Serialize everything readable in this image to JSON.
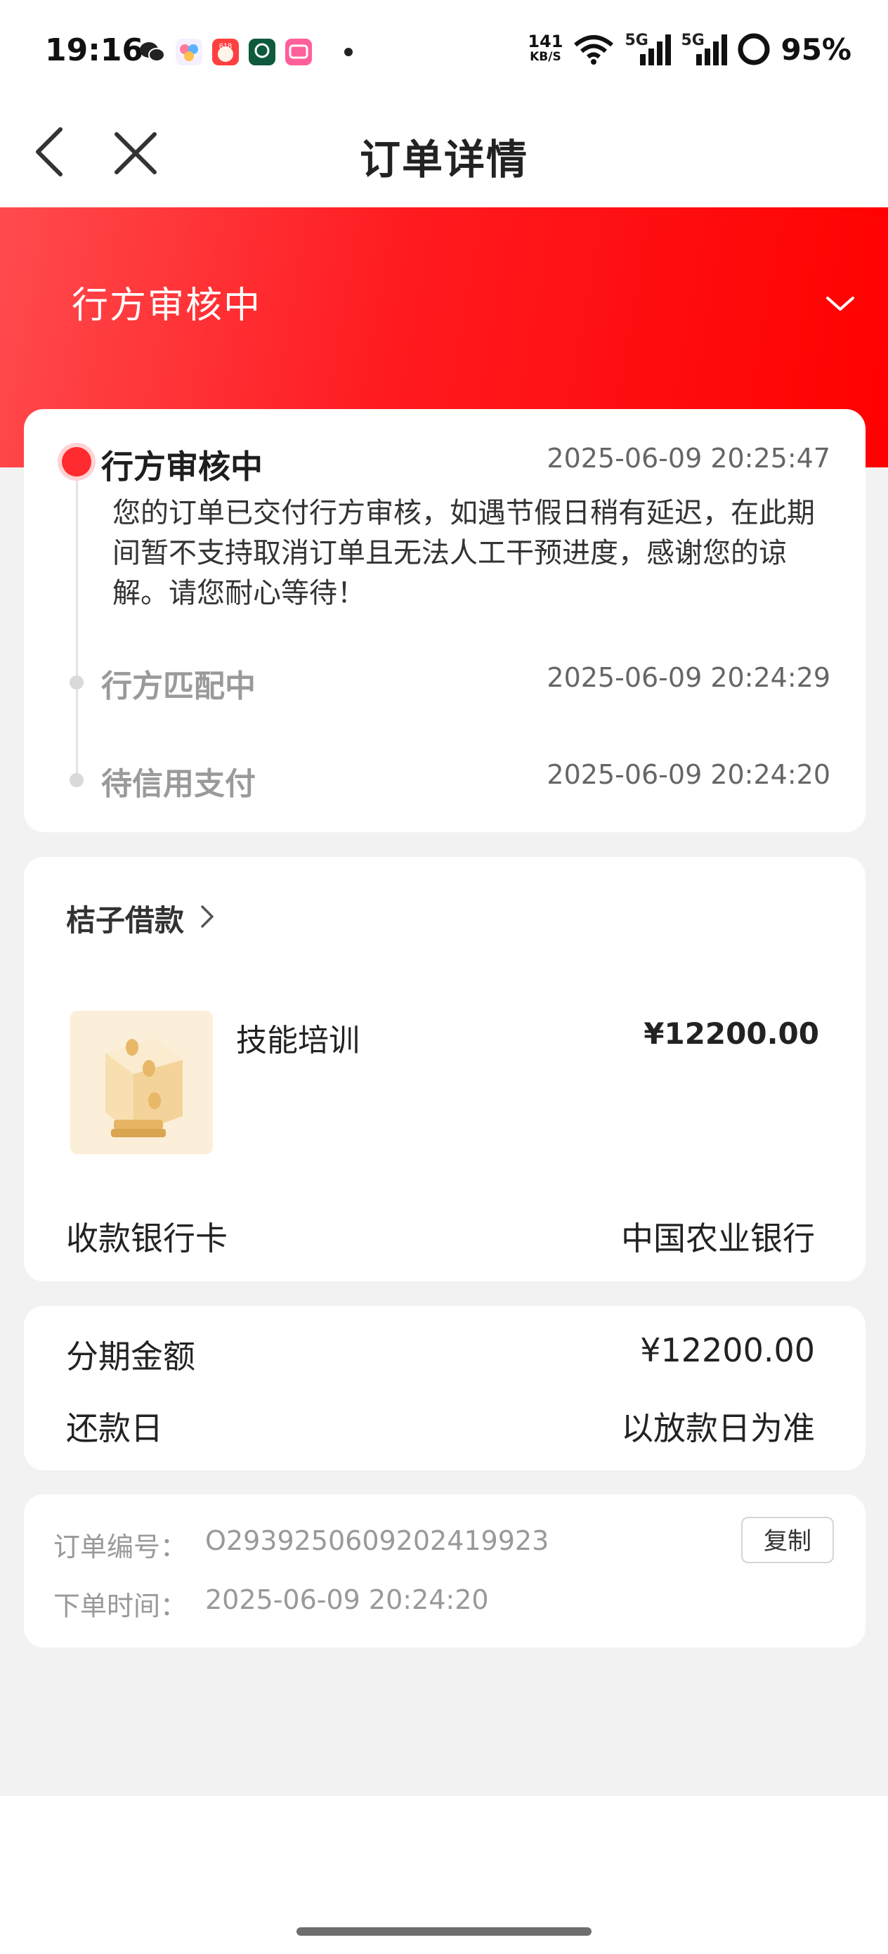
{
  "status_bar": {
    "time": "19:16",
    "net_speed_value": "141",
    "net_speed_unit": "KB/S",
    "signal_1_label": "5G",
    "signal_2_label": "5G",
    "battery_percent": "95%",
    "icons": [
      "wechat-icon",
      "app-icon",
      "618-app-icon",
      "green-app-icon",
      "bilibili-icon",
      "wifi-icon",
      "signal-icon",
      "battery-icon"
    ]
  },
  "nav": {
    "title": "订单详情"
  },
  "status_header": {
    "title": "行方审核中"
  },
  "timeline": {
    "steps": [
      {
        "title": "行方审核中",
        "time": "2025-06-09 20:25:47",
        "description": "您的订单已交付行方审核，如遇节假日稍有延迟，在此期间暂不支持取消订单且无法人工干预进度，感谢您的谅解。请您耐心等待！",
        "active": true
      },
      {
        "title": "行方匹配中",
        "time": "2025-06-09 20:24:29",
        "active": false
      },
      {
        "title": "待信用支付",
        "time": "2025-06-09 20:24:20",
        "active": false
      }
    ]
  },
  "order": {
    "merchant": "桔子借款",
    "product_name": "技能培训",
    "product_price": "¥12200.00",
    "bank_label": "收款银行卡",
    "bank_value": "中国农业银行"
  },
  "installment": {
    "amount_label": "分期金额",
    "amount_value": "¥12200.00",
    "repay_label": "还款日",
    "repay_value": "以放款日为准"
  },
  "meta": {
    "order_no_label": "订单编号：",
    "order_no_value": "O2939250609202419923",
    "copy_label": "复制",
    "order_time_label": "下单时间：",
    "order_time_value": "2025-06-09 20:24:20"
  },
  "colors": {
    "accent_red": "#ff1a1f",
    "page_bg": "#f2f2f2"
  }
}
